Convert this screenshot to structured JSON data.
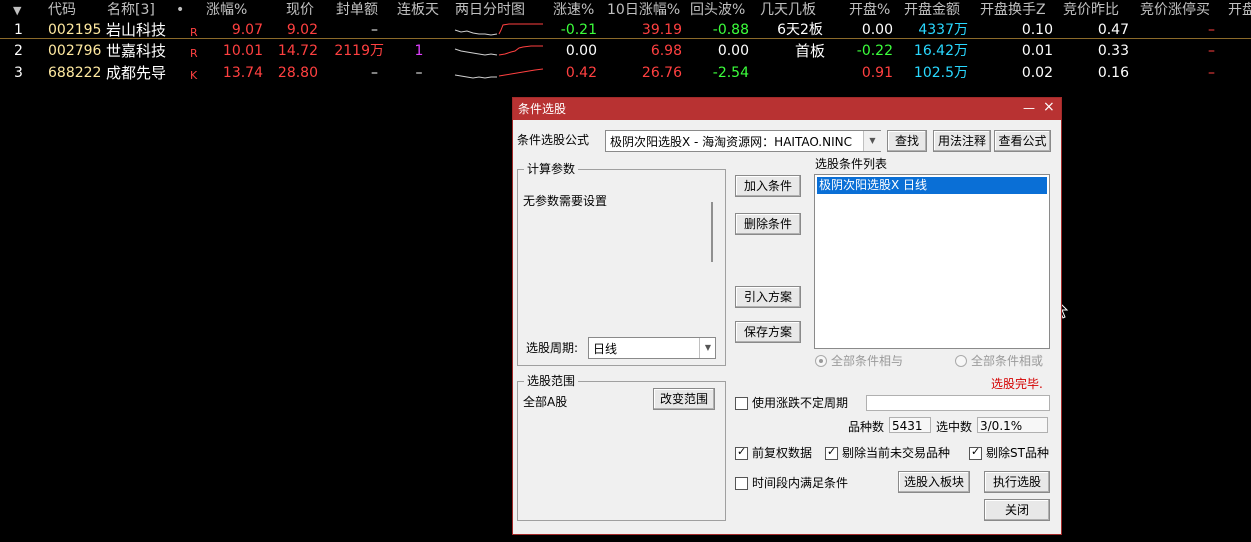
{
  "table": {
    "headers": [
      "代码",
      "名称[3]",
      "•",
      "涨幅%",
      "现价",
      "封单额",
      "连板天",
      "两日分时图",
      "涨速%",
      "10日涨幅%",
      "回头波%",
      "几天几板",
      "开盘%",
      "开盘金额",
      "开盘换手Z",
      "竞价昨比",
      "竞价涨停买",
      "开盘"
    ],
    "rows": [
      {
        "idx": "1",
        "code": "002195",
        "name": "岩山科技",
        "flag": "R",
        "chg": "9.07",
        "price": "9.02",
        "seal": "–",
        "boards": "",
        "speed": "-0.21",
        "chg10": "39.19",
        "back": "-0.88",
        "days": "6天2板",
        "openpct": "0.00",
        "openamt": "4337万",
        "turnover": "0.10",
        "ratio": "0.47",
        "limitbuy": "–"
      },
      {
        "idx": "2",
        "code": "002796",
        "name": "世嘉科技",
        "flag": "R",
        "chg": "10.01",
        "price": "14.72",
        "seal": "2119万",
        "boards": "1",
        "speed": "0.00",
        "chg10": "6.98",
        "back": "0.00",
        "days": "首板",
        "openpct": "-0.22",
        "openamt": "16.42万",
        "turnover": "0.01",
        "ratio": "0.33",
        "limitbuy": "–"
      },
      {
        "idx": "3",
        "code": "688222",
        "name": "成都先导",
        "flag": "K",
        "chg": "13.74",
        "price": "28.80",
        "seal": "–",
        "boards": "–",
        "speed": "0.42",
        "chg10": "26.76",
        "back": "-2.54",
        "days": "",
        "openpct": "0.91",
        "openamt": "102.5万",
        "turnover": "0.02",
        "ratio": "0.16",
        "limitbuy": "–"
      }
    ],
    "colors": {
      "up": "#ff4040",
      "down": "#3cff3c",
      "code": "#ffe9a0",
      "cyan": "#29d8ff",
      "magenta": "#e040ff"
    }
  },
  "dialog": {
    "title": "条件选股",
    "formula_label": "条件选股公式",
    "formula_value": "极阴次阳选股X  -  海淘资源网：HAITAO.NINC",
    "find_btn": "查找",
    "usage_btn": "用法注释",
    "view_btn": "查看公式",
    "params_group": "计算参数",
    "params_text": "无参数需要设置",
    "period_label": "选股周期:",
    "period_value": "日线",
    "scope_group": "选股范围",
    "scope_value": "全部A股",
    "change_scope_btn": "改变范围",
    "add_btn": "加入条件",
    "del_btn": "删除条件",
    "import_btn": "引入方案",
    "save_btn": "保存方案",
    "list_label": "选股条件列表",
    "list_items": [
      "极阴次阳选股X  日线"
    ],
    "radio_and": "全部条件相与",
    "radio_or": "全部条件相或",
    "status": "选股完毕.",
    "use_period_label": "使用涨跌不定周期",
    "count_label": "品种数",
    "count_value": "5431",
    "selected_label": "选中数",
    "selected_value": "3/0.1%",
    "cb_fq": "前复权数据",
    "cb_exclude_untraded": "剔除当前未交易品种",
    "cb_exclude_st": "剔除ST品种",
    "cb_time_range": "时间段内满足条件",
    "to_block_btn": "选股入板块",
    "run_btn": "执行选股",
    "close_btn": "关闭",
    "minimize_glyph": "—",
    "close_glyph": "×",
    "dropdown_glyph": "▼",
    "check_glyph": "✓",
    "sort_glyph": "▼"
  }
}
